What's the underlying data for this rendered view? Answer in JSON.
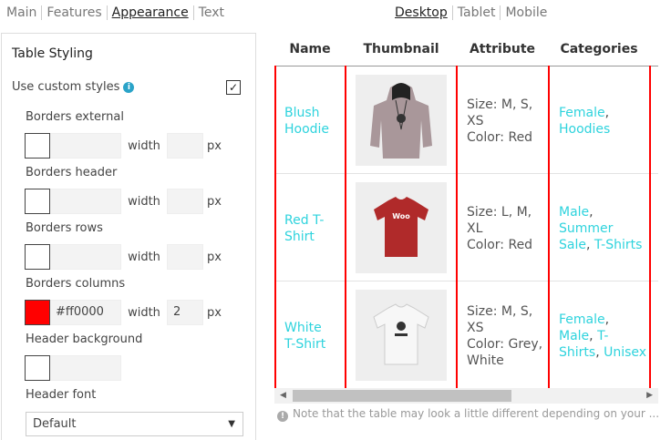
{
  "tabs": [
    "Main",
    "Features",
    "Appearance",
    "Text"
  ],
  "device_tabs": [
    "Desktop",
    "Tablet",
    "Mobile"
  ],
  "panel": {
    "title": "Table Styling",
    "use_custom_styles": "Use custom styles",
    "info_glyph": "i",
    "checkbox_glyph": "✓",
    "borders_external": "Borders external",
    "borders_header": "Borders header",
    "borders_rows": "Borders rows",
    "borders_columns": "Borders columns",
    "header_background": "Header background",
    "header_font": "Header font",
    "width_label": "width",
    "px_label": "px",
    "columns_color": "#ff0000",
    "columns_width": "2",
    "header_font_value": "Default",
    "select_arrow": "▼"
  },
  "table": {
    "headers": [
      "Name",
      "Thumbnail",
      "Attribute",
      "Categories"
    ],
    "rows": [
      {
        "name": "Blush Hoodie",
        "attr1": "Size: M, S,",
        "attr2": "XS",
        "attr3": "Color: Red",
        "attr4": "",
        "cat1": "Female",
        "cat2": "Hoodies",
        "cat3": "",
        "sep1": ","
      },
      {
        "name": "Red T-Shirt",
        "attr1": "Size: L, M,",
        "attr2": "XL",
        "attr3": "Color: Red",
        "attr4": "",
        "cat1": "Male",
        "cat2": "Summer",
        "cat3": "Sale",
        "cat4": "T-Shirts",
        "sep1": ",",
        "sep2": ","
      },
      {
        "name": "White T-Shirt",
        "attr1": "Size: M, S,",
        "attr2": "XS",
        "attr3": "Color: Grey,",
        "attr4": "White",
        "cat1": "Female",
        "cat2": "Male",
        "cat3": "T-",
        "cat4": "Shirts",
        "cat5": "Unisex",
        "sep1": ",",
        "sep2": ",",
        "sep3": ","
      }
    ],
    "name_line1": [
      "Blush",
      "Red T-",
      "White"
    ],
    "name_line2": [
      "Hoodie",
      "Shirt",
      "T-Shirt"
    ]
  },
  "scroll": {
    "left_arrow": "◀",
    "right_arrow": "▶"
  },
  "note": {
    "icon": "!",
    "text": "Note that the table may look a little different depending on your ..."
  },
  "colors": {
    "accent_link": "#2ed3dd",
    "border_red": "#ff0000"
  }
}
